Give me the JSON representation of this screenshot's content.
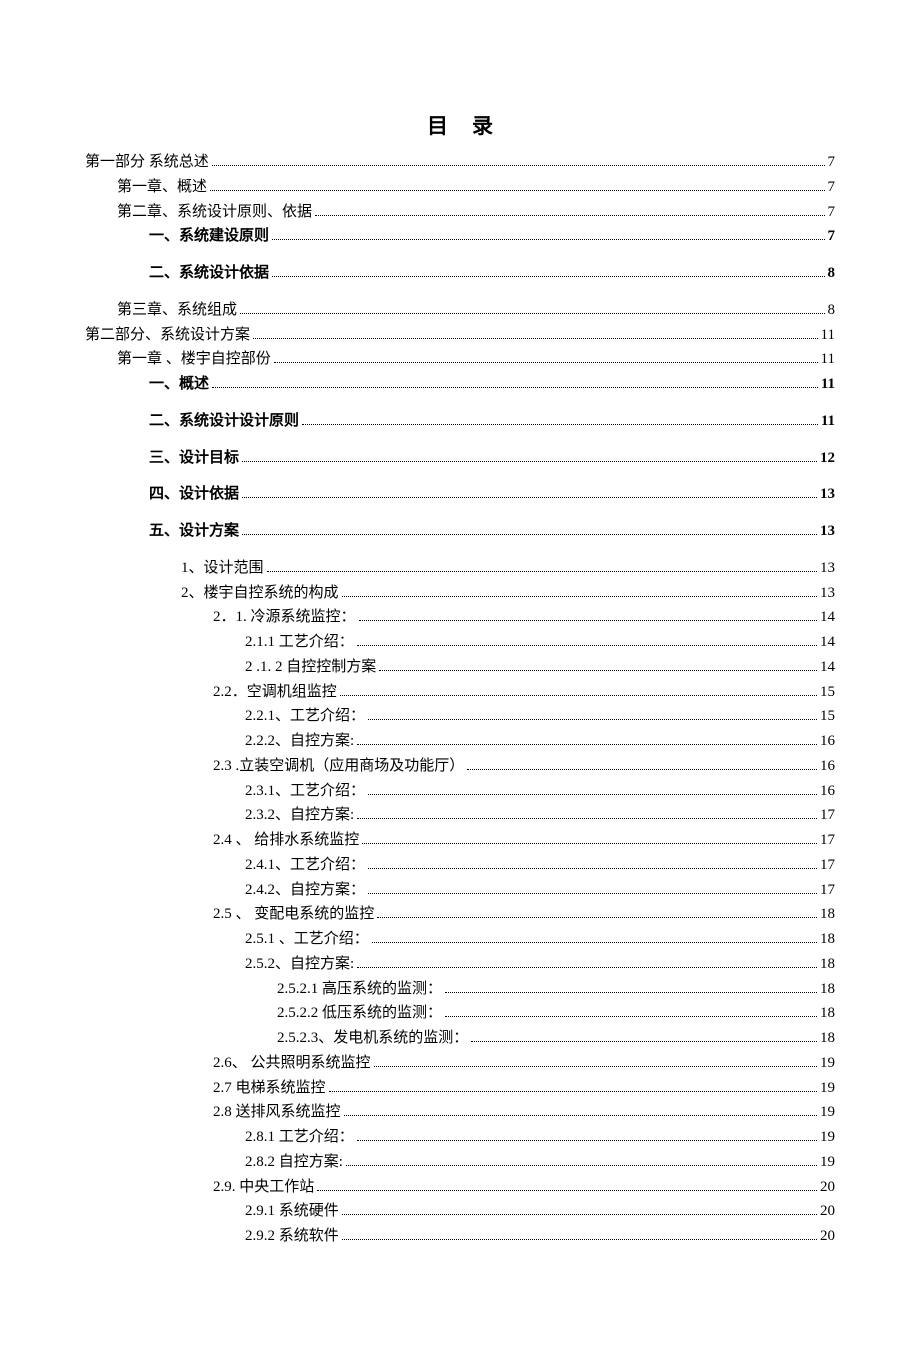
{
  "title": "目录",
  "entries": [
    {
      "label": "第一部分   系统总述",
      "page": "7",
      "indent": 0,
      "bold": false,
      "spaced": false
    },
    {
      "label": "第一章、概述",
      "page": "7",
      "indent": 1,
      "bold": false,
      "spaced": false
    },
    {
      "label": "第二章、系统设计原则、依据",
      "page": "7",
      "indent": 1,
      "bold": false,
      "spaced": false
    },
    {
      "label": "一、系统建设原则",
      "page": "7",
      "indent": 2,
      "bold": true,
      "spaced": true
    },
    {
      "label": "二、系统设计依据",
      "page": "8",
      "indent": 2,
      "bold": true,
      "spaced": true
    },
    {
      "label": "第三章、系统组成",
      "page": "8",
      "indent": 1,
      "bold": false,
      "spaced": false
    },
    {
      "label": "第二部分、系统设计方案",
      "page": "11",
      "indent": 0,
      "bold": false,
      "spaced": false
    },
    {
      "label": "第一章  、楼宇自控部份",
      "page": "11",
      "indent": 1,
      "bold": false,
      "spaced": false
    },
    {
      "label": "一、概述",
      "page": "11",
      "indent": 2,
      "bold": true,
      "spaced": true
    },
    {
      "label": "二、系统设计设计原则",
      "page": "11",
      "indent": 2,
      "bold": true,
      "spaced": true
    },
    {
      "label": "三、设计目标",
      "page": "12",
      "indent": 2,
      "bold": true,
      "spaced": true
    },
    {
      "label": "四、设计依据",
      "page": "13",
      "indent": 2,
      "bold": true,
      "spaced": true
    },
    {
      "label": "五、设计方案",
      "page": "13",
      "indent": 2,
      "bold": true,
      "spaced": true
    },
    {
      "label": "1、设计范围",
      "page": "13",
      "indent": 3,
      "bold": false,
      "spaced": false
    },
    {
      "label": "2、楼宇自控系统的构成",
      "page": "13",
      "indent": 3,
      "bold": false,
      "spaced": false
    },
    {
      "label": "2．1. 冷源系统监控：",
      "page": "14",
      "indent": 4,
      "bold": false,
      "spaced": false
    },
    {
      "label": "2.1.1 工艺介绍：",
      "page": "14",
      "indent": 5,
      "bold": false,
      "spaced": false
    },
    {
      "label": "2 .1. 2  自控控制方案",
      "page": "14",
      "indent": 5,
      "bold": false,
      "spaced": false
    },
    {
      "label": "2.2．空调机组监控",
      "page": "15",
      "indent": 4,
      "bold": false,
      "spaced": false
    },
    {
      "label": "2.2.1、工艺介绍：",
      "page": "15",
      "indent": 5,
      "bold": false,
      "spaced": false
    },
    {
      "label": "2.2.2、自控方案:",
      "page": "16",
      "indent": 5,
      "bold": false,
      "spaced": false
    },
    {
      "label": "2.3 .立装空调机（应用商场及功能厅）",
      "page": "16",
      "indent": 4,
      "bold": false,
      "spaced": false
    },
    {
      "label": "2.3.1、工艺介绍：",
      "page": "16",
      "indent": 5,
      "bold": false,
      "spaced": false
    },
    {
      "label": "2.3.2、自控方案:",
      "page": "17",
      "indent": 5,
      "bold": false,
      "spaced": false
    },
    {
      "label": "2.4 、  给排水系统监控",
      "page": "17",
      "indent": 4,
      "bold": false,
      "spaced": false
    },
    {
      "label": "2.4.1、工艺介绍：",
      "page": "17",
      "indent": 5,
      "bold": false,
      "spaced": false
    },
    {
      "label": "2.4.2、自控方案：",
      "page": "17",
      "indent": 5,
      "bold": false,
      "spaced": false
    },
    {
      "label": "2.5 、  变配电系统的监控",
      "page": "18",
      "indent": 4,
      "bold": false,
      "spaced": false
    },
    {
      "label": "2.5.1 、工艺介绍：",
      "page": "18",
      "indent": 5,
      "bold": false,
      "spaced": false
    },
    {
      "label": "2.5.2、自控方案:",
      "page": "18",
      "indent": 5,
      "bold": false,
      "spaced": false
    },
    {
      "label": "2.5.2.1 高压系统的监测：",
      "page": "18",
      "indent": 6,
      "bold": false,
      "spaced": false
    },
    {
      "label": "2.5.2.2 低压系统的监测：",
      "page": "18",
      "indent": 6,
      "bold": false,
      "spaced": false
    },
    {
      "label": "2.5.2.3、发电机系统的监测：",
      "page": "18",
      "indent": 6,
      "bold": false,
      "spaced": false
    },
    {
      "label": "2.6、   公共照明系统监控",
      "page": "19",
      "indent": 4,
      "bold": false,
      "spaced": false
    },
    {
      "label": "2.7 电梯系统监控",
      "page": "19",
      "indent": 4,
      "bold": false,
      "spaced": false
    },
    {
      "label": "2.8 送排风系统监控",
      "page": "19",
      "indent": 4,
      "bold": false,
      "spaced": false
    },
    {
      "label": "2.8.1 工艺介绍：",
      "page": "19",
      "indent": 5,
      "bold": false,
      "spaced": false
    },
    {
      "label": "2.8.2 自控方案:",
      "page": "19",
      "indent": 5,
      "bold": false,
      "spaced": false
    },
    {
      "label": "2.9. 中央工作站",
      "page": "20",
      "indent": 4,
      "bold": false,
      "spaced": false
    },
    {
      "label": "2.9.1  系统硬件",
      "page": "20",
      "indent": 5,
      "bold": false,
      "spaced": false
    },
    {
      "label": "2.9.2  系统软件",
      "page": "20",
      "indent": 5,
      "bold": false,
      "spaced": false
    }
  ]
}
